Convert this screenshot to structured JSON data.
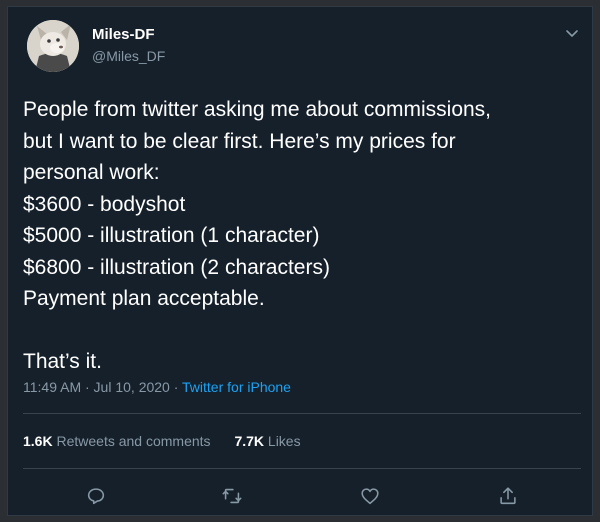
{
  "user": {
    "display_name": "Miles-DF",
    "handle": "@Miles_DF"
  },
  "tweet": {
    "lines": [
      "People from twitter asking me about commissions,",
      "but I want to be clear first. Here’s my prices for",
      "personal work:",
      "$3600 - bodyshot",
      "$5000 - illustration (1 character)",
      "$6800 - illustration (2 characters)",
      "Payment plan acceptable.",
      "",
      "That’s it."
    ],
    "time": "11:49 AM · Jul 10, 2020 · ",
    "source": "Twitter for iPhone"
  },
  "stats": {
    "retweets_count": "1.6K",
    "retweets_label": "Retweets and comments",
    "likes_count": "7.7K",
    "likes_label": "Likes"
  },
  "icons": {
    "menu": "chevron-down-icon",
    "reply": "reply-icon",
    "retweet": "retweet-icon",
    "like": "heart-icon",
    "share": "share-icon"
  },
  "colors": {
    "background": "#15202b",
    "text": "#ffffff",
    "muted": "#8899a6",
    "accent": "#1da1f2"
  }
}
